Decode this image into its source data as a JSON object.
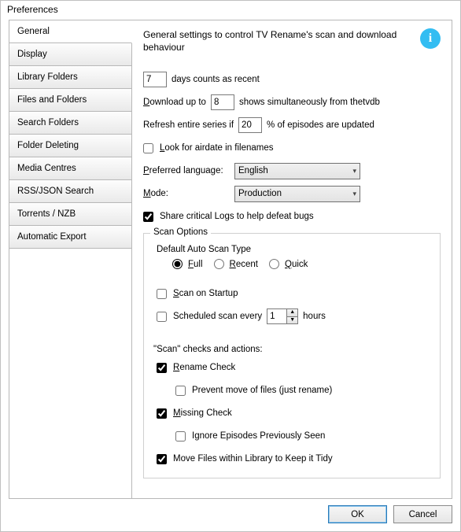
{
  "window_title": "Preferences",
  "sidebar": {
    "items": [
      {
        "label": "General"
      },
      {
        "label": "Display"
      },
      {
        "label": "Library Folders"
      },
      {
        "label": "Files and Folders"
      },
      {
        "label": "Search Folders"
      },
      {
        "label": "Folder Deleting"
      },
      {
        "label": "Media Centres"
      },
      {
        "label": "RSS/JSON Search"
      },
      {
        "label": "Torrents / NZB"
      },
      {
        "label": "Automatic Export"
      }
    ],
    "selected_index": 0
  },
  "description": "General settings to control TV Rename's scan and download behaviour",
  "fields": {
    "recent_days_value": "7",
    "recent_days_suffix": "days counts as recent",
    "download_prefix": "Download up to",
    "download_value": "8",
    "download_suffix": "shows simultaneously from thetvdb",
    "refresh_prefix": "Refresh entire series if",
    "refresh_value": "20",
    "refresh_suffix": "% of episodes are updated",
    "look_airdate_label": "Look for airdate in filenames",
    "pref_lang_label": "Preferred language:",
    "pref_lang_value": "English",
    "mode_label": "Mode:",
    "mode_value": "Production",
    "share_logs_label": "Share critical Logs to help defeat bugs"
  },
  "scan": {
    "legend": "Scan Options",
    "default_scan_type_label": "Default Auto Scan Type",
    "full_label": "Full",
    "recent_label": "Recent",
    "quick_label": "Quick",
    "scan_startup_label": "Scan on Startup",
    "scheduled_prefix": "Scheduled scan every",
    "scheduled_value": "1",
    "scheduled_suffix": "hours",
    "checks_actions_label": "\"Scan\" checks and actions:",
    "rename_check_label": "Rename Check",
    "prevent_move_label": "Prevent move of files (just rename)",
    "missing_check_label": "Missing Check",
    "ignore_prev_seen_label": "Ignore Episodes Previously Seen",
    "move_tidy_label": "Move Files within Library to Keep it Tidy"
  },
  "buttons": {
    "ok": "OK",
    "cancel": "Cancel"
  }
}
